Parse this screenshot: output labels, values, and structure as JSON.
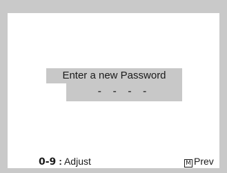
{
  "dialog": {
    "prompt": "Enter a new Password",
    "password_mask": "- - - -"
  },
  "footer": {
    "keys": "0-9",
    "separator": ":",
    "adjust_label": "Adjust",
    "menu_icon_glyph": "M",
    "prev_label": "Prev"
  },
  "colors": {
    "frame": "#c9c9c9",
    "screen": "#ffffff",
    "highlight": "#c8c8c8",
    "text": "#1a1a1a"
  }
}
